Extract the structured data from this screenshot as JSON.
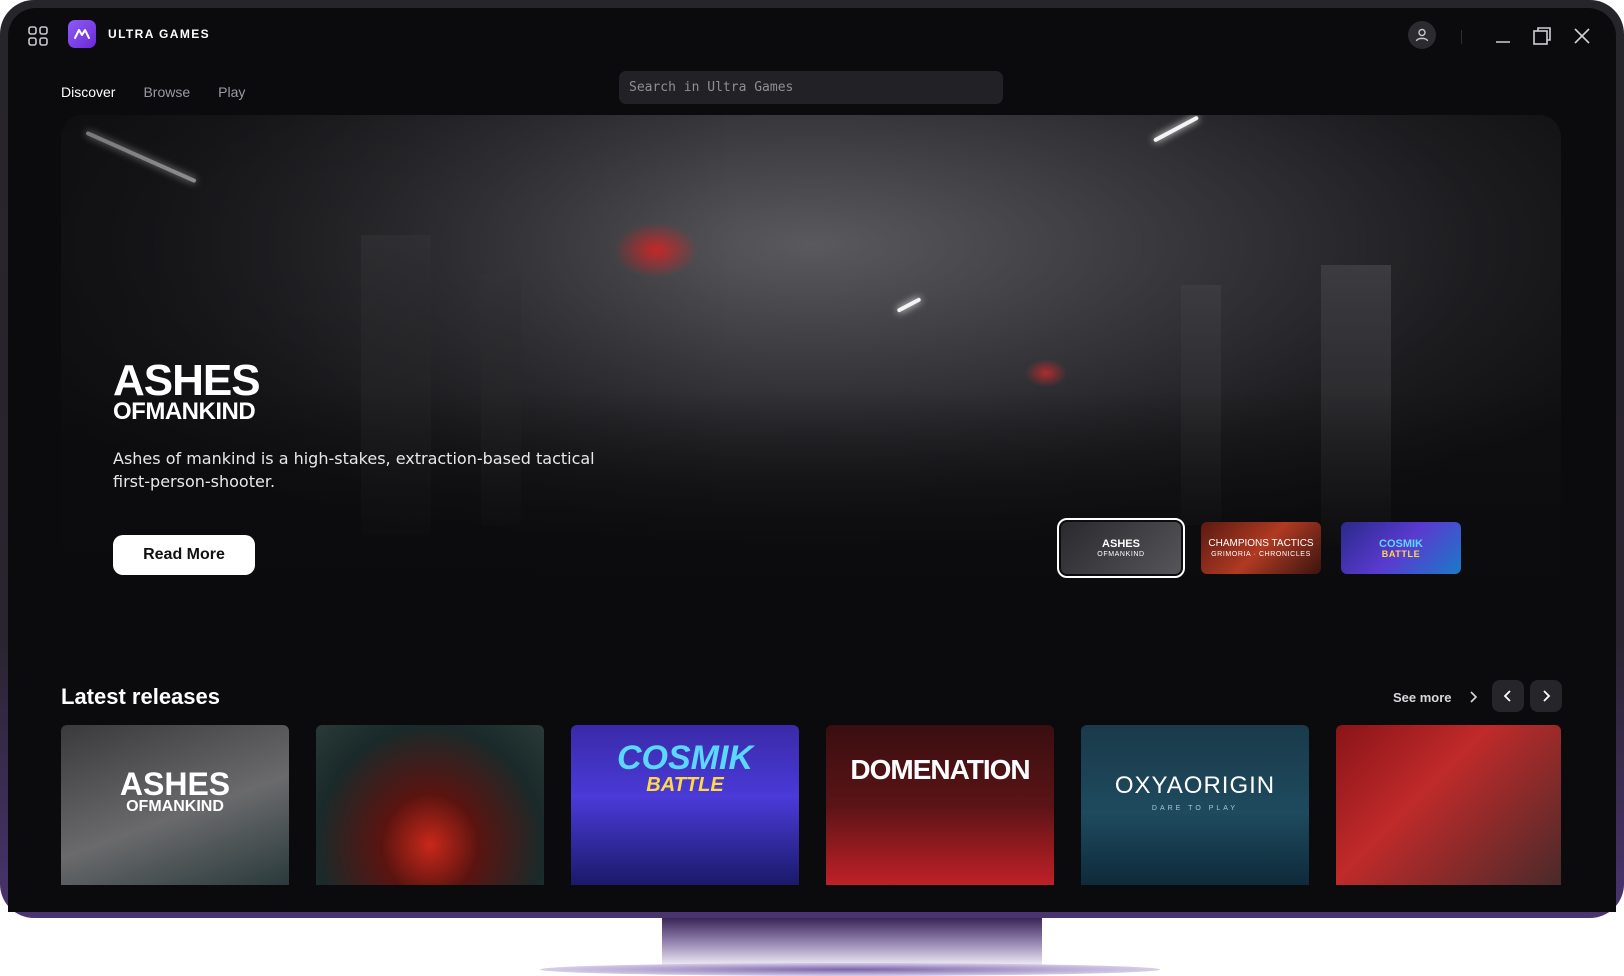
{
  "brand": {
    "name": "ULTRA GAMES"
  },
  "nav": {
    "tabs": [
      {
        "label": "Discover",
        "active": true
      },
      {
        "label": "Browse"
      },
      {
        "label": "Play"
      }
    ]
  },
  "search": {
    "placeholder": "Search in Ultra Games",
    "value": ""
  },
  "hero": {
    "logo_line1": "ASHES",
    "logo_line2": "OFMANKIND",
    "description": "Ashes of mankind is a high-stakes, extraction-based tactical first-person-shooter.",
    "button_label": "Read More",
    "thumbnails": [
      {
        "title": "ASHES",
        "subtitle": "OFMANKIND",
        "active": true
      },
      {
        "title": "CHAMPIONS TACTICS",
        "subtitle": "GRIMORIA · CHRONICLES"
      },
      {
        "title": "COSMIK",
        "subtitle": "BATTLE"
      }
    ]
  },
  "latest": {
    "title": "Latest releases",
    "see_more": "See more",
    "cards": [
      {
        "title": "ASHES",
        "subtitle": "OFMANKIND"
      },
      {
        "title": "",
        "subtitle": ""
      },
      {
        "title": "COSMIK",
        "subtitle": "BATTLE"
      },
      {
        "title": "DOMENATION",
        "subtitle": ""
      },
      {
        "title": "OXYAORIGIN",
        "subtitle": "DARE TO PLAY"
      },
      {
        "title": "",
        "subtitle": ""
      }
    ]
  },
  "colors": {
    "accent": "#7c3aed",
    "background": "#0b0b0d",
    "surface": "#222226"
  },
  "icons": {
    "apps": "grid-icon",
    "logo": "infinity-icon",
    "user": "user-icon",
    "minimize": "minimize-icon",
    "restore": "restore-icon",
    "close": "close-icon"
  }
}
